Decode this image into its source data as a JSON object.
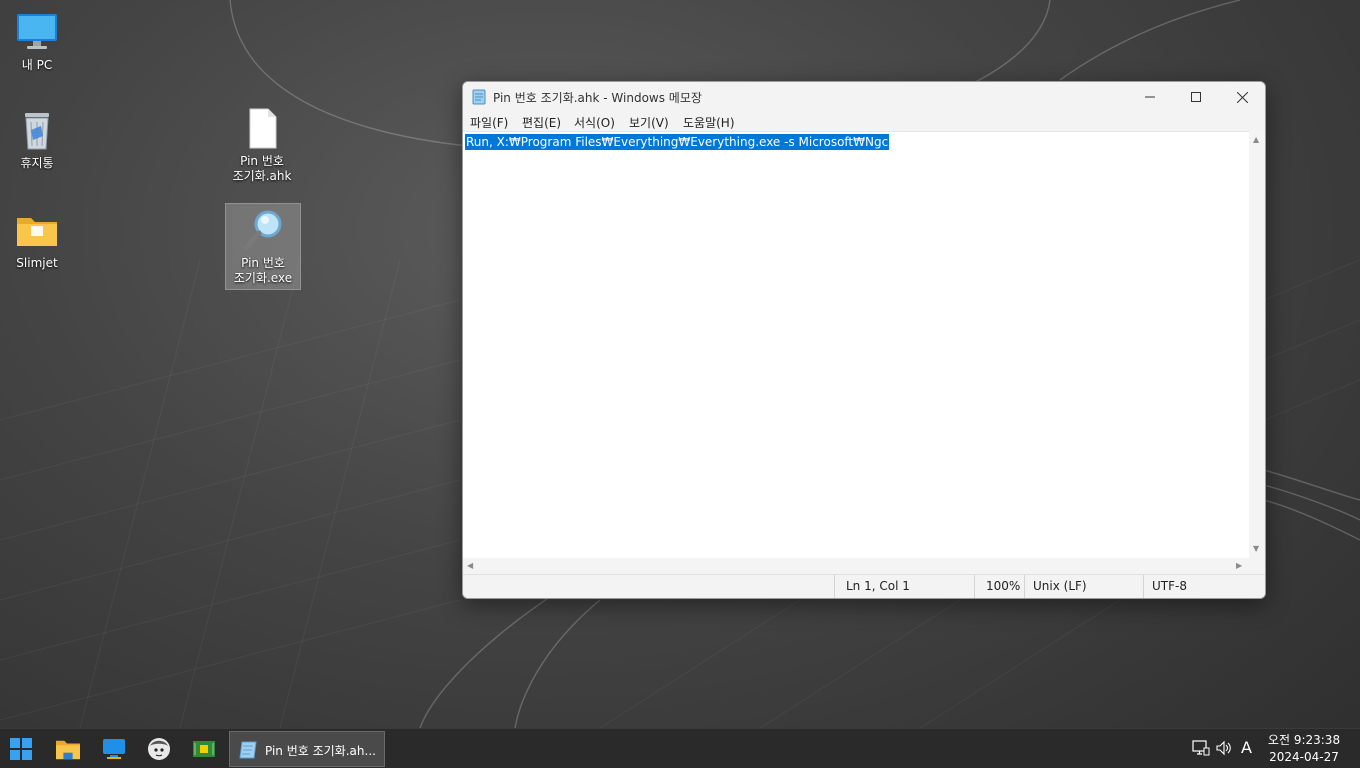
{
  "desktop": {
    "icons": [
      {
        "label": "내 PC"
      },
      {
        "label": "휴지통"
      },
      {
        "label": "Slimjet"
      },
      {
        "label_line1": "Pin 번호",
        "label_line2": "조기화.ahk"
      },
      {
        "label_line1": "Pin 번호",
        "label_line2": "조기화.exe"
      }
    ]
  },
  "notepad": {
    "title": "Pin 번호 조기화.ahk - Windows 메모장",
    "menu": [
      "파일(F)",
      "편집(E)",
      "서식(O)",
      "보기(V)",
      "도움말(H)"
    ],
    "content": "Run, X:₩Program Files₩Everything₩Everything.exe -s Microsoft₩Ngc",
    "status": {
      "position": "Ln 1, Col 1",
      "zoom": "100%",
      "line_ending": "Unix (LF)",
      "encoding": "UTF-8"
    }
  },
  "taskbar": {
    "active_window_label": "Pin 번호 조기화.ah...",
    "tray_keyboard": "A",
    "clock_time": "오전 9:23:38",
    "clock_date": "2024-04-27"
  },
  "colors": {
    "selection": "#0078d7",
    "start_blue": "#0a84d6"
  }
}
